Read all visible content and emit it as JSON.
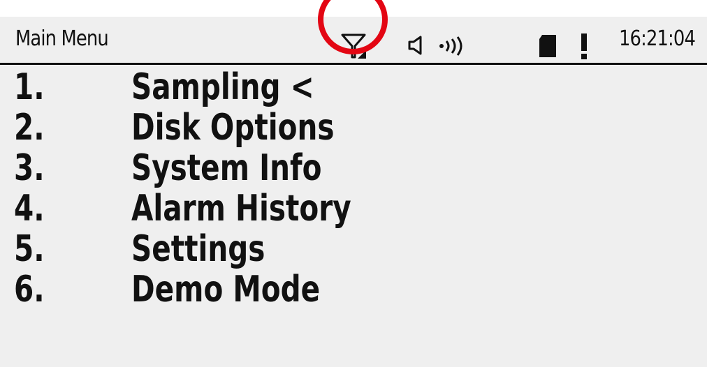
{
  "status_bar": {
    "title": "Main Menu",
    "time": "16:21:04",
    "icons": [
      "filter-signal-icon",
      "speaker-icon",
      "signal-waves-icon",
      "sd-card-icon",
      "alert-icon"
    ],
    "highlight_color": "#e30613"
  },
  "menu": {
    "items": [
      {
        "number": "1.",
        "label": "Sampling <"
      },
      {
        "number": "2.",
        "label": "Disk Options"
      },
      {
        "number": "3.",
        "label": "System Info"
      },
      {
        "number": "4.",
        "label": "Alarm History"
      },
      {
        "number": "5.",
        "label": "Settings"
      },
      {
        "number": "6.",
        "label": "Demo Mode"
      }
    ]
  },
  "colors": {
    "screen_background": "#efefef",
    "text": "#111111",
    "highlight": "#e30613"
  }
}
